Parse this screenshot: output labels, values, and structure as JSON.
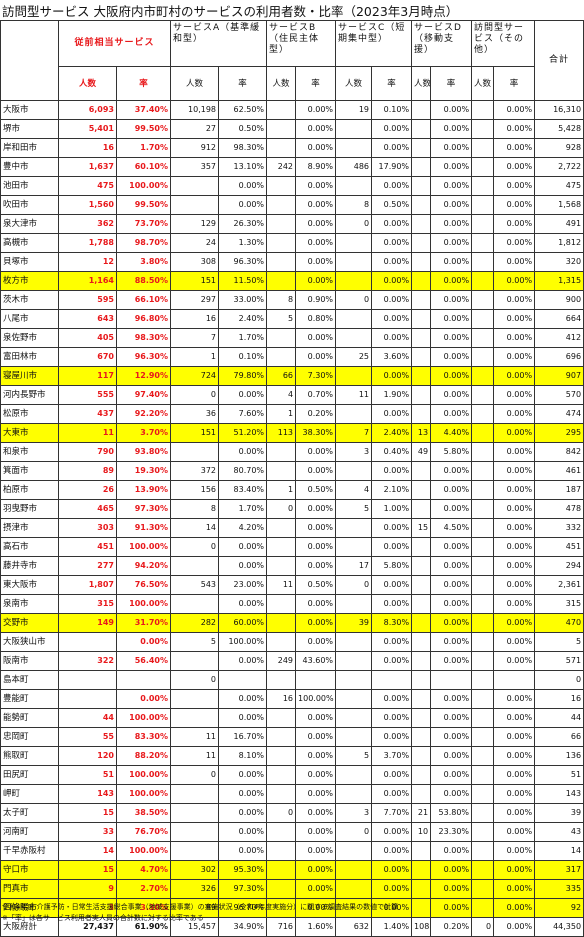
{
  "title": "訪問型サービス 大阪府内市町村のサービスの利用者数・比率（2023年3月時点）",
  "header": {
    "group_labels": {
      "juzen": "従前相当サービス",
      "a": "サービスA（基準緩和型）",
      "b": "サービスB（住民主体型）",
      "c": "サービスC（短期集中型）",
      "d": "サービスD（移動支援）",
      "other": "訪問型サービス（その他）",
      "total": "合計"
    },
    "sub_labels": {
      "juzen_count": "人数",
      "juzen_rate": "率",
      "count": "人数",
      "rate": "率"
    }
  },
  "colors": {
    "highlight": "#ffff00",
    "emphasis": "#e8191c"
  },
  "rows": [
    {
      "name": "大阪市",
      "j_n": "6,093",
      "j_r": "37.40%",
      "a_n": "10,198",
      "a_r": "62.50%",
      "b_n": "",
      "b_r": "0.00%",
      "c_n": "19",
      "c_r": "0.10%",
      "d_n": "",
      "d_r": "0.00%",
      "o_n": "",
      "o_r": "0.00%",
      "total": "16,310",
      "hl": false
    },
    {
      "name": "堺市",
      "j_n": "5,401",
      "j_r": "99.50%",
      "a_n": "27",
      "a_r": "0.50%",
      "b_n": "",
      "b_r": "0.00%",
      "c_n": "",
      "c_r": "0.00%",
      "d_n": "",
      "d_r": "0.00%",
      "o_n": "",
      "o_r": "0.00%",
      "total": "5,428",
      "hl": false
    },
    {
      "name": "岸和田市",
      "j_n": "16",
      "j_r": "1.70%",
      "a_n": "912",
      "a_r": "98.30%",
      "b_n": "",
      "b_r": "0.00%",
      "c_n": "",
      "c_r": "0.00%",
      "d_n": "",
      "d_r": "0.00%",
      "o_n": "",
      "o_r": "0.00%",
      "total": "928",
      "hl": false
    },
    {
      "name": "豊中市",
      "j_n": "1,637",
      "j_r": "60.10%",
      "a_n": "357",
      "a_r": "13.10%",
      "b_n": "242",
      "b_r": "8.90%",
      "c_n": "486",
      "c_r": "17.90%",
      "d_n": "",
      "d_r": "0.00%",
      "o_n": "",
      "o_r": "0.00%",
      "total": "2,722",
      "hl": false
    },
    {
      "name": "池田市",
      "j_n": "475",
      "j_r": "100.00%",
      "a_n": "",
      "a_r": "0.00%",
      "b_n": "",
      "b_r": "0.00%",
      "c_n": "",
      "c_r": "0.00%",
      "d_n": "",
      "d_r": "0.00%",
      "o_n": "",
      "o_r": "0.00%",
      "total": "475",
      "hl": false
    },
    {
      "name": "吹田市",
      "j_n": "1,560",
      "j_r": "99.50%",
      "a_n": "",
      "a_r": "0.00%",
      "b_n": "",
      "b_r": "0.00%",
      "c_n": "8",
      "c_r": "0.50%",
      "d_n": "",
      "d_r": "0.00%",
      "o_n": "",
      "o_r": "0.00%",
      "total": "1,568",
      "hl": false
    },
    {
      "name": "泉大津市",
      "j_n": "362",
      "j_r": "73.70%",
      "a_n": "129",
      "a_r": "26.30%",
      "b_n": "",
      "b_r": "0.00%",
      "c_n": "0",
      "c_r": "0.00%",
      "d_n": "",
      "d_r": "0.00%",
      "o_n": "",
      "o_r": "0.00%",
      "total": "491",
      "hl": false
    },
    {
      "name": "高槻市",
      "j_n": "1,788",
      "j_r": "98.70%",
      "a_n": "24",
      "a_r": "1.30%",
      "b_n": "",
      "b_r": "0.00%",
      "c_n": "",
      "c_r": "0.00%",
      "d_n": "",
      "d_r": "0.00%",
      "o_n": "",
      "o_r": "0.00%",
      "total": "1,812",
      "hl": false
    },
    {
      "name": "貝塚市",
      "j_n": "12",
      "j_r": "3.80%",
      "a_n": "308",
      "a_r": "96.30%",
      "b_n": "",
      "b_r": "0.00%",
      "c_n": "",
      "c_r": "0.00%",
      "d_n": "",
      "d_r": "0.00%",
      "o_n": "",
      "o_r": "0.00%",
      "total": "320",
      "hl": false
    },
    {
      "name": "枚方市",
      "j_n": "1,164",
      "j_r": "88.50%",
      "a_n": "151",
      "a_r": "11.50%",
      "b_n": "",
      "b_r": "0.00%",
      "c_n": "",
      "c_r": "0.00%",
      "d_n": "",
      "d_r": "0.00%",
      "o_n": "",
      "o_r": "0.00%",
      "total": "1,315",
      "hl": true
    },
    {
      "name": "茨木市",
      "j_n": "595",
      "j_r": "66.10%",
      "a_n": "297",
      "a_r": "33.00%",
      "b_n": "8",
      "b_r": "0.90%",
      "c_n": "0",
      "c_r": "0.00%",
      "d_n": "",
      "d_r": "0.00%",
      "o_n": "",
      "o_r": "0.00%",
      "total": "900",
      "hl": false
    },
    {
      "name": "八尾市",
      "j_n": "643",
      "j_r": "96.80%",
      "a_n": "16",
      "a_r": "2.40%",
      "b_n": "5",
      "b_r": "0.80%",
      "c_n": "",
      "c_r": "0.00%",
      "d_n": "",
      "d_r": "0.00%",
      "o_n": "",
      "o_r": "0.00%",
      "total": "664",
      "hl": false
    },
    {
      "name": "泉佐野市",
      "j_n": "405",
      "j_r": "98.30%",
      "a_n": "7",
      "a_r": "1.70%",
      "b_n": "",
      "b_r": "0.00%",
      "c_n": "",
      "c_r": "0.00%",
      "d_n": "",
      "d_r": "0.00%",
      "o_n": "",
      "o_r": "0.00%",
      "total": "412",
      "hl": false
    },
    {
      "name": "富田林市",
      "j_n": "670",
      "j_r": "96.30%",
      "a_n": "1",
      "a_r": "0.10%",
      "b_n": "",
      "b_r": "0.00%",
      "c_n": "25",
      "c_r": "3.60%",
      "d_n": "",
      "d_r": "0.00%",
      "o_n": "",
      "o_r": "0.00%",
      "total": "696",
      "hl": false
    },
    {
      "name": "寝屋川市",
      "j_n": "117",
      "j_r": "12.90%",
      "a_n": "724",
      "a_r": "79.80%",
      "b_n": "66",
      "b_r": "7.30%",
      "c_n": "",
      "c_r": "0.00%",
      "d_n": "",
      "d_r": "0.00%",
      "o_n": "",
      "o_r": "0.00%",
      "total": "907",
      "hl": true
    },
    {
      "name": "河内長野市",
      "j_n": "555",
      "j_r": "97.40%",
      "a_n": "0",
      "a_r": "0.00%",
      "b_n": "4",
      "b_r": "0.70%",
      "c_n": "11",
      "c_r": "1.90%",
      "d_n": "",
      "d_r": "0.00%",
      "o_n": "",
      "o_r": "0.00%",
      "total": "570",
      "hl": false
    },
    {
      "name": "松原市",
      "j_n": "437",
      "j_r": "92.20%",
      "a_n": "36",
      "a_r": "7.60%",
      "b_n": "1",
      "b_r": "0.20%",
      "c_n": "",
      "c_r": "0.00%",
      "d_n": "",
      "d_r": "0.00%",
      "o_n": "",
      "o_r": "0.00%",
      "total": "474",
      "hl": false
    },
    {
      "name": "大東市",
      "j_n": "11",
      "j_r": "3.70%",
      "a_n": "151",
      "a_r": "51.20%",
      "b_n": "113",
      "b_r": "38.30%",
      "c_n": "7",
      "c_r": "2.40%",
      "d_n": "13",
      "d_r": "4.40%",
      "o_n": "",
      "o_r": "0.00%",
      "total": "295",
      "hl": true
    },
    {
      "name": "和泉市",
      "j_n": "790",
      "j_r": "93.80%",
      "a_n": "",
      "a_r": "0.00%",
      "b_n": "",
      "b_r": "0.00%",
      "c_n": "3",
      "c_r": "0.40%",
      "d_n": "49",
      "d_r": "5.80%",
      "o_n": "",
      "o_r": "0.00%",
      "total": "842",
      "hl": false
    },
    {
      "name": "箕面市",
      "j_n": "89",
      "j_r": "19.30%",
      "a_n": "372",
      "a_r": "80.70%",
      "b_n": "",
      "b_r": "0.00%",
      "c_n": "",
      "c_r": "0.00%",
      "d_n": "",
      "d_r": "0.00%",
      "o_n": "",
      "o_r": "0.00%",
      "total": "461",
      "hl": false
    },
    {
      "name": "柏原市",
      "j_n": "26",
      "j_r": "13.90%",
      "a_n": "156",
      "a_r": "83.40%",
      "b_n": "1",
      "b_r": "0.50%",
      "c_n": "4",
      "c_r": "2.10%",
      "d_n": "",
      "d_r": "0.00%",
      "o_n": "",
      "o_r": "0.00%",
      "total": "187",
      "hl": false
    },
    {
      "name": "羽曳野市",
      "j_n": "465",
      "j_r": "97.30%",
      "a_n": "8",
      "a_r": "1.70%",
      "b_n": "0",
      "b_r": "0.00%",
      "c_n": "5",
      "c_r": "1.00%",
      "d_n": "",
      "d_r": "0.00%",
      "o_n": "",
      "o_r": "0.00%",
      "total": "478",
      "hl": false
    },
    {
      "name": "摂津市",
      "j_n": "303",
      "j_r": "91.30%",
      "a_n": "14",
      "a_r": "4.20%",
      "b_n": "",
      "b_r": "0.00%",
      "c_n": "",
      "c_r": "0.00%",
      "d_n": "15",
      "d_r": "4.50%",
      "o_n": "",
      "o_r": "0.00%",
      "total": "332",
      "hl": false
    },
    {
      "name": "高石市",
      "j_n": "451",
      "j_r": "100.00%",
      "a_n": "0",
      "a_r": "0.00%",
      "b_n": "",
      "b_r": "0.00%",
      "c_n": "",
      "c_r": "0.00%",
      "d_n": "",
      "d_r": "0.00%",
      "o_n": "",
      "o_r": "0.00%",
      "total": "451",
      "hl": false
    },
    {
      "name": "藤井寺市",
      "j_n": "277",
      "j_r": "94.20%",
      "a_n": "",
      "a_r": "0.00%",
      "b_n": "",
      "b_r": "0.00%",
      "c_n": "17",
      "c_r": "5.80%",
      "d_n": "",
      "d_r": "0.00%",
      "o_n": "",
      "o_r": "0.00%",
      "total": "294",
      "hl": false
    },
    {
      "name": "東大阪市",
      "j_n": "1,807",
      "j_r": "76.50%",
      "a_n": "543",
      "a_r": "23.00%",
      "b_n": "11",
      "b_r": "0.50%",
      "c_n": "0",
      "c_r": "0.00%",
      "d_n": "",
      "d_r": "0.00%",
      "o_n": "",
      "o_r": "0.00%",
      "total": "2,361",
      "hl": false
    },
    {
      "name": "泉南市",
      "j_n": "315",
      "j_r": "100.00%",
      "a_n": "",
      "a_r": "0.00%",
      "b_n": "",
      "b_r": "0.00%",
      "c_n": "",
      "c_r": "0.00%",
      "d_n": "",
      "d_r": "0.00%",
      "o_n": "",
      "o_r": "0.00%",
      "total": "315",
      "hl": false
    },
    {
      "name": "交野市",
      "j_n": "149",
      "j_r": "31.70%",
      "a_n": "282",
      "a_r": "60.00%",
      "b_n": "",
      "b_r": "0.00%",
      "c_n": "39",
      "c_r": "8.30%",
      "d_n": "",
      "d_r": "0.00%",
      "o_n": "",
      "o_r": "0.00%",
      "total": "470",
      "hl": true
    },
    {
      "name": "大阪狭山市",
      "j_n": "",
      "j_r": "0.00%",
      "a_n": "5",
      "a_r": "100.00%",
      "b_n": "",
      "b_r": "0.00%",
      "c_n": "",
      "c_r": "0.00%",
      "d_n": "",
      "d_r": "0.00%",
      "o_n": "",
      "o_r": "0.00%",
      "total": "5",
      "hl": false
    },
    {
      "name": "阪南市",
      "j_n": "322",
      "j_r": "56.40%",
      "a_n": "",
      "a_r": "0.00%",
      "b_n": "249",
      "b_r": "43.60%",
      "c_n": "",
      "c_r": "0.00%",
      "d_n": "",
      "d_r": "0.00%",
      "o_n": "",
      "o_r": "0.00%",
      "total": "571",
      "hl": false
    },
    {
      "name": "島本町",
      "j_n": "",
      "j_r": "",
      "a_n": "0",
      "a_r": "",
      "b_n": "",
      "b_r": "",
      "c_n": "",
      "c_r": "",
      "d_n": "",
      "d_r": "",
      "o_n": "",
      "o_r": "",
      "total": "0",
      "hl": false
    },
    {
      "name": "豊能町",
      "j_n": "",
      "j_r": "0.00%",
      "a_n": "",
      "a_r": "0.00%",
      "b_n": "16",
      "b_r": "100.00%",
      "c_n": "",
      "c_r": "0.00%",
      "d_n": "",
      "d_r": "0.00%",
      "o_n": "",
      "o_r": "0.00%",
      "total": "16",
      "hl": false
    },
    {
      "name": "能勢町",
      "j_n": "44",
      "j_r": "100.00%",
      "a_n": "",
      "a_r": "0.00%",
      "b_n": "",
      "b_r": "0.00%",
      "c_n": "",
      "c_r": "0.00%",
      "d_n": "",
      "d_r": "0.00%",
      "o_n": "",
      "o_r": "0.00%",
      "total": "44",
      "hl": false
    },
    {
      "name": "忠岡町",
      "j_n": "55",
      "j_r": "83.30%",
      "a_n": "11",
      "a_r": "16.70%",
      "b_n": "",
      "b_r": "0.00%",
      "c_n": "",
      "c_r": "0.00%",
      "d_n": "",
      "d_r": "0.00%",
      "o_n": "",
      "o_r": "0.00%",
      "total": "66",
      "hl": false
    },
    {
      "name": "熊取町",
      "j_n": "120",
      "j_r": "88.20%",
      "a_n": "11",
      "a_r": "8.10%",
      "b_n": "",
      "b_r": "0.00%",
      "c_n": "5",
      "c_r": "3.70%",
      "d_n": "",
      "d_r": "0.00%",
      "o_n": "",
      "o_r": "0.00%",
      "total": "136",
      "hl": false
    },
    {
      "name": "田尻町",
      "j_n": "51",
      "j_r": "100.00%",
      "a_n": "0",
      "a_r": "0.00%",
      "b_n": "",
      "b_r": "0.00%",
      "c_n": "",
      "c_r": "0.00%",
      "d_n": "",
      "d_r": "0.00%",
      "o_n": "",
      "o_r": "0.00%",
      "total": "51",
      "hl": false
    },
    {
      "name": "岬町",
      "j_n": "143",
      "j_r": "100.00%",
      "a_n": "",
      "a_r": "0.00%",
      "b_n": "",
      "b_r": "0.00%",
      "c_n": "",
      "c_r": "0.00%",
      "d_n": "",
      "d_r": "0.00%",
      "o_n": "",
      "o_r": "0.00%",
      "total": "143",
      "hl": false
    },
    {
      "name": "太子町",
      "j_n": "15",
      "j_r": "38.50%",
      "a_n": "",
      "a_r": "0.00%",
      "b_n": "0",
      "b_r": "0.00%",
      "c_n": "3",
      "c_r": "7.70%",
      "d_n": "21",
      "d_r": "53.80%",
      "o_n": "",
      "o_r": "0.00%",
      "total": "39",
      "hl": false
    },
    {
      "name": "河南町",
      "j_n": "33",
      "j_r": "76.70%",
      "a_n": "",
      "a_r": "0.00%",
      "b_n": "",
      "b_r": "0.00%",
      "c_n": "0",
      "c_r": "0.00%",
      "d_n": "10",
      "d_r": "23.30%",
      "o_n": "",
      "o_r": "0.00%",
      "total": "43",
      "hl": false
    },
    {
      "name": "千早赤阪村",
      "j_n": "14",
      "j_r": "100.00%",
      "a_n": "",
      "a_r": "0.00%",
      "b_n": "",
      "b_r": "0.00%",
      "c_n": "",
      "c_r": "0.00%",
      "d_n": "",
      "d_r": "0.00%",
      "o_n": "",
      "o_r": "0.00%",
      "total": "14",
      "hl": false
    },
    {
      "name": "守口市",
      "j_n": "15",
      "j_r": "4.70%",
      "a_n": "302",
      "a_r": "95.30%",
      "b_n": "",
      "b_r": "0.00%",
      "c_n": "",
      "c_r": "0.00%",
      "d_n": "",
      "d_r": "0.00%",
      "o_n": "",
      "o_r": "0.00%",
      "total": "317",
      "hl": true
    },
    {
      "name": "門真市",
      "j_n": "9",
      "j_r": "2.70%",
      "a_n": "326",
      "a_r": "97.30%",
      "b_n": "",
      "b_r": "0.00%",
      "c_n": "",
      "c_r": "0.00%",
      "d_n": "",
      "d_r": "0.00%",
      "o_n": "",
      "o_r": "0.00%",
      "total": "335",
      "hl": true
    },
    {
      "name": "四條畷市",
      "j_n": "3",
      "j_r": "3.30%",
      "a_n": "89",
      "a_r": "96.70%",
      "b_n": "",
      "b_r": "0.00%",
      "c_n": "",
      "c_r": "0.00%",
      "d_n": "",
      "d_r": "0.00%",
      "o_n": "",
      "o_r": "0.00%",
      "total": "92",
      "hl": true
    },
    {
      "name": "大阪府計",
      "j_n": "27,437",
      "j_r": "61.90%",
      "a_n": "15,457",
      "a_r": "34.90%",
      "b_n": "716",
      "b_r": "1.60%",
      "c_n": "632",
      "c_r": "1.40%",
      "d_n": "108",
      "d_r": "0.20%",
      "o_n": "0",
      "o_r": "0.00%",
      "total": "44,350",
      "hl": false
    }
  ],
  "footnotes": [
    "令和4年度 介護予防・日常生活支援総合事業（地域支援事業）の実施状況（令和4年度実施分）に関する調査結果の数値で計算",
    "※「率」は各サービス利用者実人員の合計数に対する比率である"
  ]
}
